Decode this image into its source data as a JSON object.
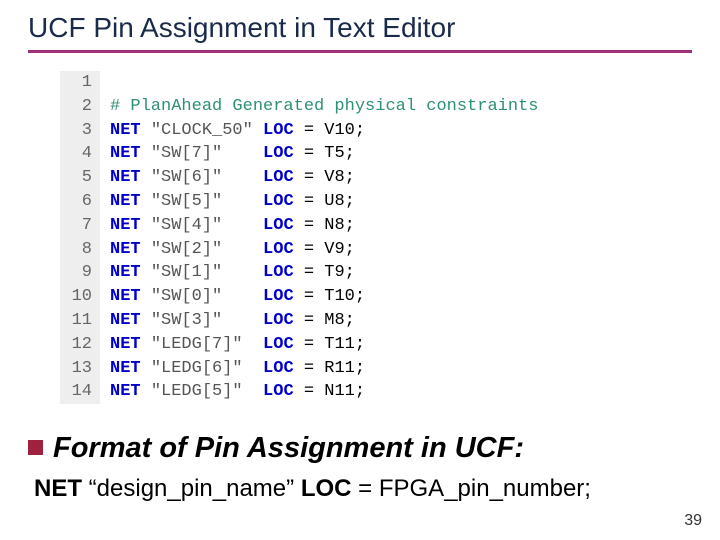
{
  "title": "UCF Pin Assignment in Text Editor",
  "code": {
    "comment": "# PlanAhead Generated physical constraints",
    "lines": [
      {
        "n": 1,
        "type": "blank"
      },
      {
        "n": 2,
        "type": "comment"
      },
      {
        "n": 3,
        "type": "net",
        "name": "\"CLOCK_50\"",
        "pin": "V10"
      },
      {
        "n": 4,
        "type": "net",
        "name": "\"SW[7]\"",
        "pin": "T5"
      },
      {
        "n": 5,
        "type": "net",
        "name": "\"SW[6]\"",
        "pin": "V8"
      },
      {
        "n": 6,
        "type": "net",
        "name": "\"SW[5]\"",
        "pin": "U8"
      },
      {
        "n": 7,
        "type": "net",
        "name": "\"SW[4]\"",
        "pin": "N8"
      },
      {
        "n": 8,
        "type": "net",
        "name": "\"SW[2]\"",
        "pin": "V9"
      },
      {
        "n": 9,
        "type": "net",
        "name": "\"SW[1]\"",
        "pin": "T9"
      },
      {
        "n": 10,
        "type": "net",
        "name": "\"SW[0]\"",
        "pin": "T10"
      },
      {
        "n": 11,
        "type": "net",
        "name": "\"SW[3]\"",
        "pin": "M8"
      },
      {
        "n": 12,
        "type": "net",
        "name": "\"LEDG[7]\"",
        "pin": "T11"
      },
      {
        "n": 13,
        "type": "net",
        "name": "\"LEDG[6]\"",
        "pin": "R11"
      },
      {
        "n": 14,
        "type": "net",
        "name": "\"LEDG[5]\"",
        "pin": "N11"
      }
    ],
    "keywords": {
      "net": "NET",
      "loc": "LOC"
    }
  },
  "format": {
    "heading": "Format of Pin Assignment in UCF:",
    "syntax": {
      "net_kw": "NET",
      "name_ph": "“design_pin_name”",
      "loc_kw": "LOC",
      "eq": " = ",
      "pin_ph": "FPGA_pin_number;"
    }
  },
  "page_number": "39"
}
